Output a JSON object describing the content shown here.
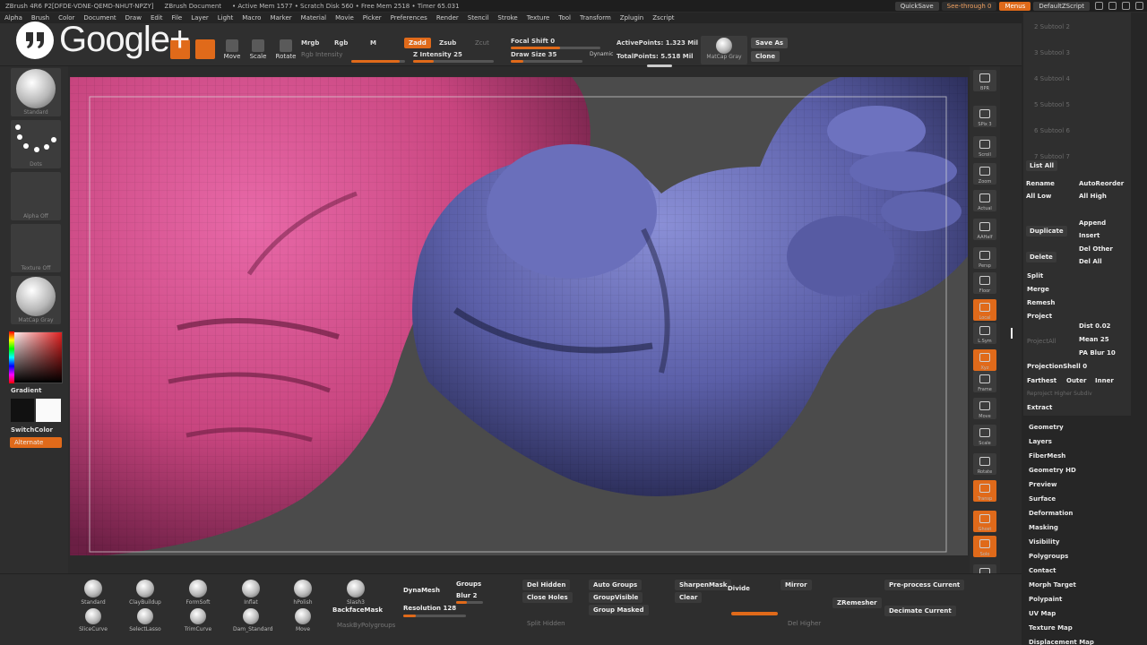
{
  "titlebar": {
    "app": "ZBrush 4R6 P2[DFDE-VDNE-QEMD-NHUT-NPZY]",
    "doc": "ZBrush Document",
    "mem": "• Active Mem 1577 • Scratch Disk 560 • Free Mem 2518 • Timer 65.031",
    "quicksave": "QuickSave",
    "seethrough": "See-through  0",
    "menus": "Menus",
    "script": "DefaultZScript"
  },
  "menu": [
    "Alpha",
    "Brush",
    "Color",
    "Document",
    "Draw",
    "Edit",
    "File",
    "Layer",
    "Light",
    "Macro",
    "Marker",
    "Material",
    "Movie",
    "Picker",
    "Preferences",
    "Render",
    "Stencil",
    "Stroke",
    "Texture",
    "Tool",
    "Transform",
    "Zplugin",
    "Zscript"
  ],
  "overlay": {
    "brand": "Google+"
  },
  "toolbar": {
    "move": "Move",
    "scale": "Scale",
    "rotate": "Rotate",
    "mrgb": "Mrgb",
    "rgb": "Rgb",
    "m": "M",
    "zadd": "Zadd",
    "zsub": "Zsub",
    "zcut": "Zcut",
    "rgb_intensity": "Rgb Intensity",
    "z_intensity": "Z Intensity 25",
    "focal_shift": "Focal Shift 0",
    "draw_size": "Draw Size 35",
    "dynamic": "Dynamic",
    "active_points": "ActivePoints: 1.323  Mil",
    "total_points": "TotalPoints: 5.518  Mil",
    "material": "MatCap Gray",
    "save_as": "Save As",
    "clone": "Clone"
  },
  "leftshelf": {
    "standard": "Standard",
    "dots": "Dots",
    "alpha": "Alpha Off",
    "texture": "Texture Off",
    "matcap": "MatCap Gray",
    "gradient": "Gradient",
    "switchcolor": "SwitchColor",
    "alternate": "Alternate"
  },
  "rightshelf": [
    "BPR",
    "SPix 3",
    "Scroll",
    "Zoom",
    "Actual",
    "AAHalf",
    "Persp",
    "Floor",
    "Local",
    "L.Sym",
    "Xyz",
    "Frame",
    "Move",
    "Scale",
    "Rotate",
    "Transp",
    "Ghost",
    "Solo",
    "Xpose"
  ],
  "palette": {
    "subtools": [
      "2 Subtool 2",
      "3 Subtool 3",
      "4 Subtool 4",
      "5 Subtool 5",
      "6 Subtool 6",
      "7 Subtool 7"
    ],
    "list_all": "List All",
    "rename": "Rename",
    "autoreorder": "AutoReorder",
    "all_low": "All Low",
    "all_high": "All High",
    "duplicate": "Duplicate",
    "append": "Append",
    "insert": "Insert",
    "delete": "Delete",
    "del_other": "Del Other",
    "del_all": "Del All",
    "split": "Split",
    "merge": "Merge",
    "remesh": "Remesh",
    "project": "Project",
    "project_all": "ProjectAll",
    "dist": "Dist 0.02",
    "mean": "Mean 25",
    "pa_blur": "PA Blur 10",
    "projection_shell": "ProjectionShell 0",
    "farthest": "Farthest",
    "outer": "Outer",
    "inner": "Inner",
    "reproject": "Reproject Higher Subdiv",
    "extract": "Extract",
    "sections": [
      "Geometry",
      "Layers",
      "FiberMesh",
      "Geometry HD",
      "Preview",
      "Surface",
      "Deformation",
      "Masking",
      "Visibility",
      "Polygroups",
      "Contact",
      "Morph Target",
      "Polypaint",
      "UV Map",
      "Texture Map",
      "Displacement Map"
    ]
  },
  "bottomshelf": {
    "brushes_top": [
      "Standard",
      "ClayBuildup",
      "FormSoft",
      "Inflat",
      "hPolish",
      "Slash3"
    ],
    "brushes_bottom": [
      "SliceCurve",
      "SelectLasso",
      "TrimCurve",
      "Dam_Standard",
      "Move"
    ],
    "dynamesh": "DynaMesh",
    "groups": "Groups",
    "blur": "Blur 2",
    "backfacemask": "BackfaceMask",
    "resolution": "Resolution 128",
    "mask_by_polygroups": "MaskByPolygroups",
    "del_hidden": "Del Hidden",
    "close_holes": "Close Holes",
    "split_hidden": "Split Hidden",
    "auto_groups": "Auto Groups",
    "group_visible": "GroupVisible",
    "group_masked": "Group Masked",
    "sharpen_mask": "SharpenMask",
    "clear": "Clear",
    "divide": "Divide",
    "mirror": "Mirror",
    "zremesher": "ZRemesher",
    "del_higher": "Del Higher",
    "preprocess": "Pre-process Current",
    "decimate": "Decimate Current"
  },
  "colors": {
    "accent": "#e06a1a",
    "pink_mesh": "#c8457f",
    "blue_mesh": "#5b5fa8",
    "bg": "#4b4b4b"
  }
}
